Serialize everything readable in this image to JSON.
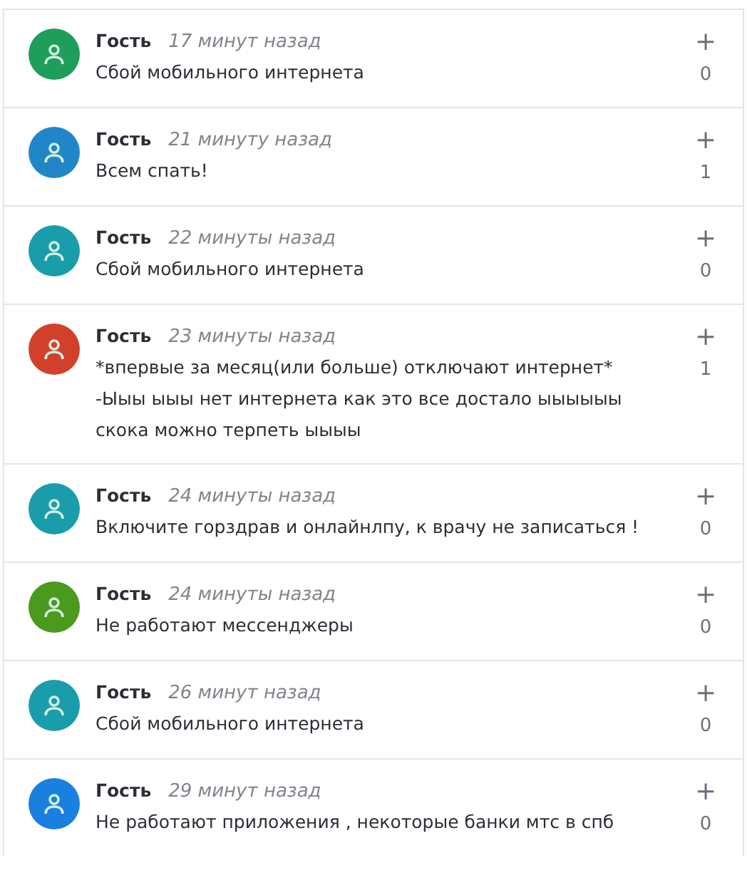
{
  "comments": [
    {
      "author": "Гость",
      "time": "17 минут назад",
      "color": "#1f9d5a",
      "lines": [
        "Сбой мобильного интернета"
      ],
      "plus": "+",
      "count": "0"
    },
    {
      "author": "Гость",
      "time": "21 минуту назад",
      "color": "#2186c8",
      "lines": [
        "Всем спать!"
      ],
      "plus": "+",
      "count": "1"
    },
    {
      "author": "Гость",
      "time": "22 минуты назад",
      "color": "#1a9daa",
      "lines": [
        "Сбой мобильного интернета"
      ],
      "plus": "+",
      "count": "0"
    },
    {
      "author": "Гость",
      "time": "23 минуты назад",
      "color": "#d2402c",
      "lines": [
        "*впервые за месяц(или больше) отключают интернет*",
        "-Ыыы ыыы нет интернета как это все достало ыыыыыы скока можно терпеть ыыыы"
      ],
      "plus": "+",
      "count": "1"
    },
    {
      "author": "Гость",
      "time": "24 минуты назад",
      "color": "#1a9daa",
      "lines": [
        "Включите горздрав и онлайнлпу, к врачу не записаться !"
      ],
      "plus": "+",
      "count": "0"
    },
    {
      "author": "Гость",
      "time": "24 минуты назад",
      "color": "#4a9a1e",
      "lines": [
        "Не работают мессенджеры"
      ],
      "plus": "+",
      "count": "0"
    },
    {
      "author": "Гость",
      "time": "26 минут назад",
      "color": "#1a9daa",
      "lines": [
        "Сбой мобильного интернета"
      ],
      "plus": "+",
      "count": "0"
    },
    {
      "author": "Гость",
      "time": "29 минут назад",
      "color": "#1a80e0",
      "lines": [
        "Не работают приложения , некоторые банки мтс в спб"
      ],
      "plus": "+",
      "count": "0"
    }
  ]
}
